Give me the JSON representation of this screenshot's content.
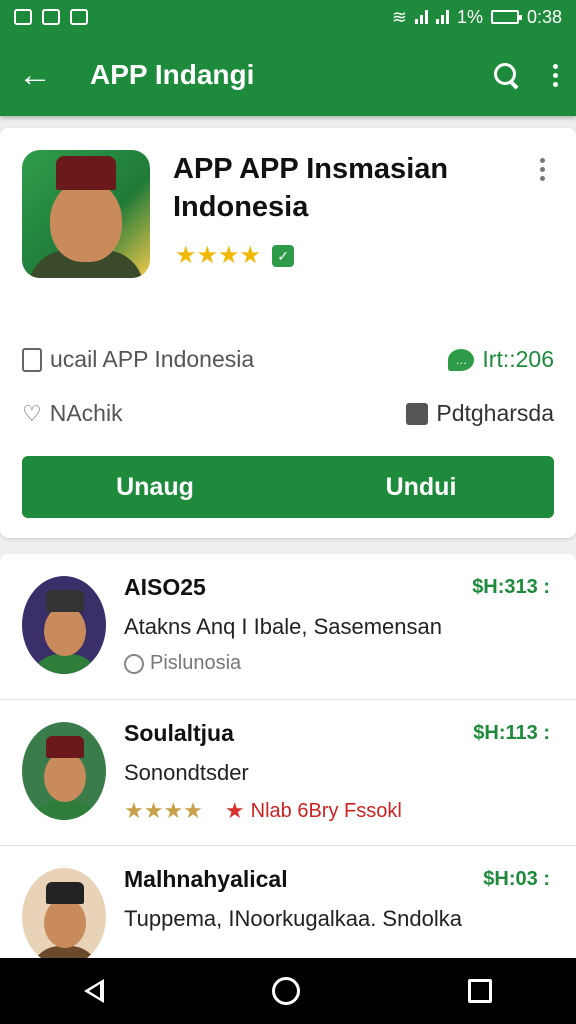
{
  "status_bar": {
    "battery": "1%",
    "time": "0:38"
  },
  "app_bar": {
    "title": "APP Indangi"
  },
  "app": {
    "title": "APP APP Insmasian Indonesia",
    "stars": "★★★★",
    "developer": "ucail APP Indonesia",
    "reviews": "Irt::206",
    "category": "NAchik",
    "publisher": "Pdtgharsda",
    "buttons": [
      "Unaug",
      "Undui"
    ]
  },
  "list": [
    {
      "name": "AISO25",
      "subtitle": "Atakns Anq I Ibale, Sasemensan",
      "meta": "Pislunosia",
      "price": "$H:313 :",
      "thumb_bg": "#3b2f6a"
    },
    {
      "name": "Soulaltjua",
      "subtitle": "Sonondtsder",
      "meta_stars": "★★★★",
      "meta_red": "Nlab 6Bry Fssokl",
      "price": "$H:113 :",
      "thumb_bg": "#3a7d4a"
    },
    {
      "name": "Malhnahyalical",
      "subtitle": "Tuppema, INoorkugalkaa. Sndolka",
      "price": "$H:03 :",
      "thumb_bg": "#e9d3b8"
    }
  ],
  "colors": {
    "primary": "#1e8a3c",
    "star": "#f2b807"
  }
}
